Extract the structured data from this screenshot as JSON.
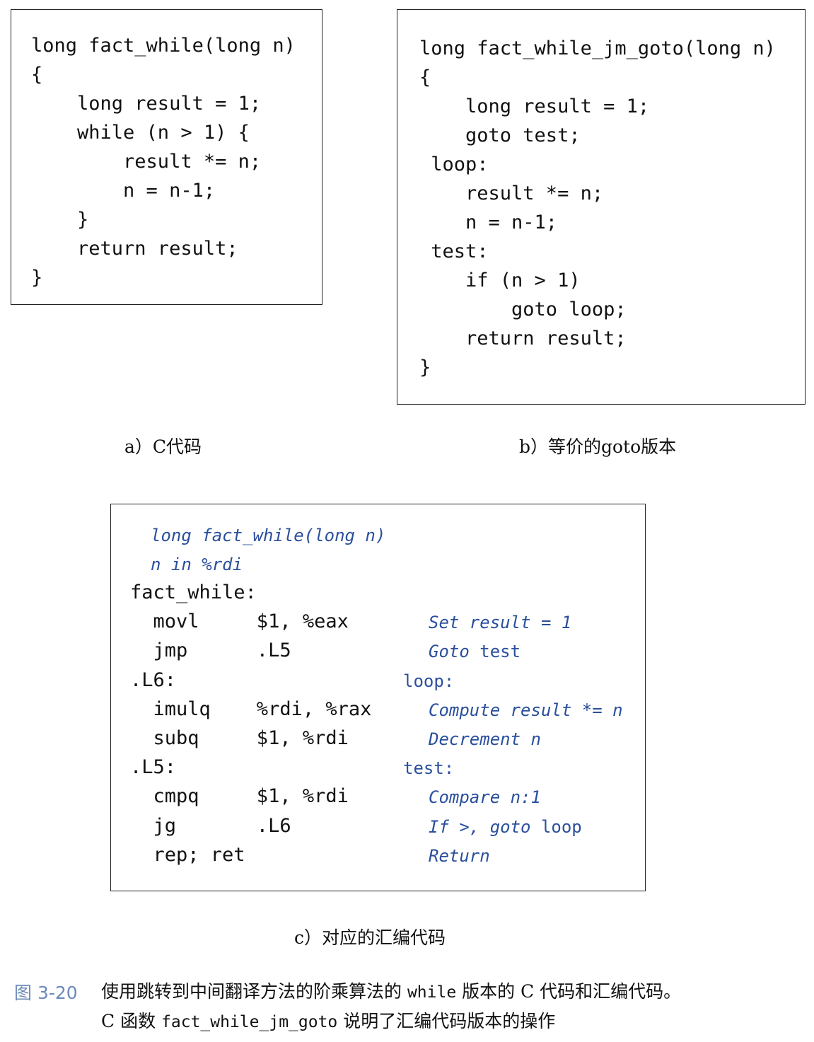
{
  "panel_a": {
    "lines": [
      "long fact_while(long n)",
      "{",
      "    long result = 1;",
      "    while (n > 1) {",
      "        result *= n;",
      "        n = n-1;",
      "    }",
      "    return result;",
      "}"
    ],
    "caption": "a）C代码"
  },
  "panel_b": {
    "lines": [
      "long fact_while_jm_goto(long n)",
      "{",
      "    long result = 1;",
      "    goto test;",
      " loop:",
      "    result *= n;",
      "    n = n-1;",
      " test:",
      "    if (n > 1)",
      "        goto loop;",
      "    return result;",
      "}"
    ],
    "caption": "b）等价的goto版本"
  },
  "panel_c": {
    "header_comment_1": "long fact_while(long n)",
    "header_comment_2": "n in %rdi",
    "rows": [
      {
        "code": "fact_while:",
        "comment": ""
      },
      {
        "code": "  movl     $1, %eax",
        "comment": "Set result = 1"
      },
      {
        "code": "  jmp      .L5",
        "comment": "Goto test"
      },
      {
        "code": ".L6:",
        "label": "loop:"
      },
      {
        "code": "  imulq    %rdi, %rax",
        "comment": "Compute result *= n"
      },
      {
        "code": "  subq     $1, %rdi",
        "comment": "Decrement n"
      },
      {
        "code": ".L5:",
        "label": "test:"
      },
      {
        "code": "  cmpq     $1, %rdi",
        "comment": "Compare n:1"
      },
      {
        "code": "  jg       .L6",
        "comment": "If >, goto loop"
      },
      {
        "code": "  rep; ret",
        "comment": "Return"
      }
    ],
    "caption": "c）对应的汇编代码"
  },
  "figure": {
    "label": "图 3-20",
    "text_line1_a": "使用跳转到中间翻译方法的阶乘算法的 ",
    "text_line1_code": "while",
    "text_line1_b": " 版本的 C 代码和汇编代码。",
    "text_line2_a": "C 函数 ",
    "text_line2_code": "fact_while_jm_goto",
    "text_line2_b": " 说明了汇编代码版本的操作"
  },
  "colors": {
    "comment": "#2a4f9c",
    "figure_label": "#6b8ab8",
    "text": "#111111"
  }
}
